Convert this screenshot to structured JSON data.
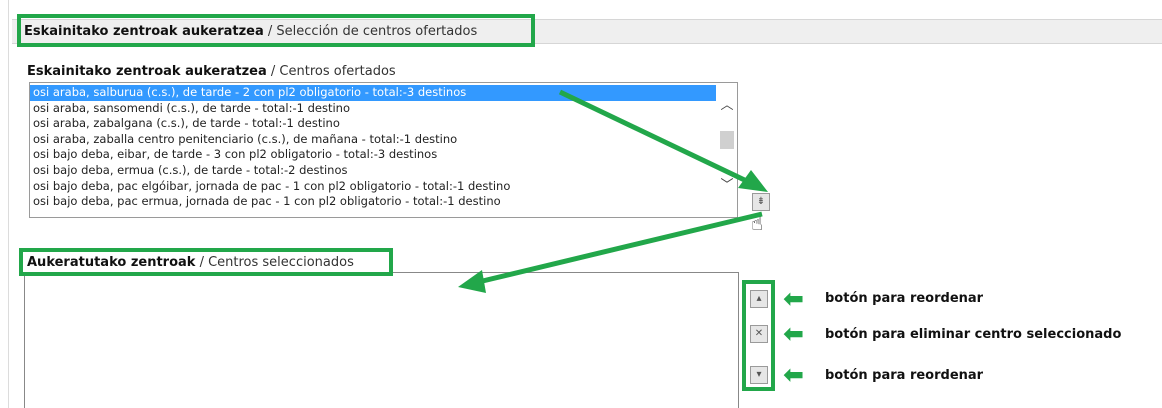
{
  "section": {
    "title_bold": "Eskainitako zentroak aukeratzea",
    "title_sub": " / Selección de centros ofertados"
  },
  "offered": {
    "label_bold": "Eskainitako zentroak aukeratzea",
    "label_sub": " / Centros ofertados",
    "items": [
      "osi araba, salburua (c.s.), de tarde - 2 con pl2 obligatorio - total:-3 destinos",
      "osi araba, sansomendi (c.s.), de tarde - total:-1 destino",
      "osi araba, zabalgana (c.s.), de tarde - total:-1 destino",
      "osi araba, zaballa centro penitenciario (c.s.), de mañana - total:-1 destino",
      "osi bajo deba, eibar, de tarde - 3 con pl2 obligatorio - total:-3 destinos",
      "osi bajo deba, ermua (c.s.), de tarde - total:-2 destinos",
      "osi bajo deba, pac elgóibar, jornada de pac - 1 con pl2 obligatorio - total:-1 destino",
      "osi bajo deba, pac ermua, jornada de pac - 1 con pl2 obligatorio - total:-1 destino"
    ],
    "selected_index": 0
  },
  "selected": {
    "label_bold": "Aukeratutako zentroak",
    "label_sub": " / Centros seleccionados"
  },
  "buttons": {
    "add_icon": "double-down-arrow-icon",
    "up_icon": "up-arrow-icon",
    "remove_icon": "x-icon",
    "down_icon": "down-arrow-icon"
  },
  "annotations": {
    "reorder_up": "botón para reordenar",
    "remove": "botón para eliminar centro seleccionado",
    "reorder_down": "botón para reordenar"
  },
  "colors": {
    "highlight": "#22a74a",
    "selection": "#3399ff"
  }
}
